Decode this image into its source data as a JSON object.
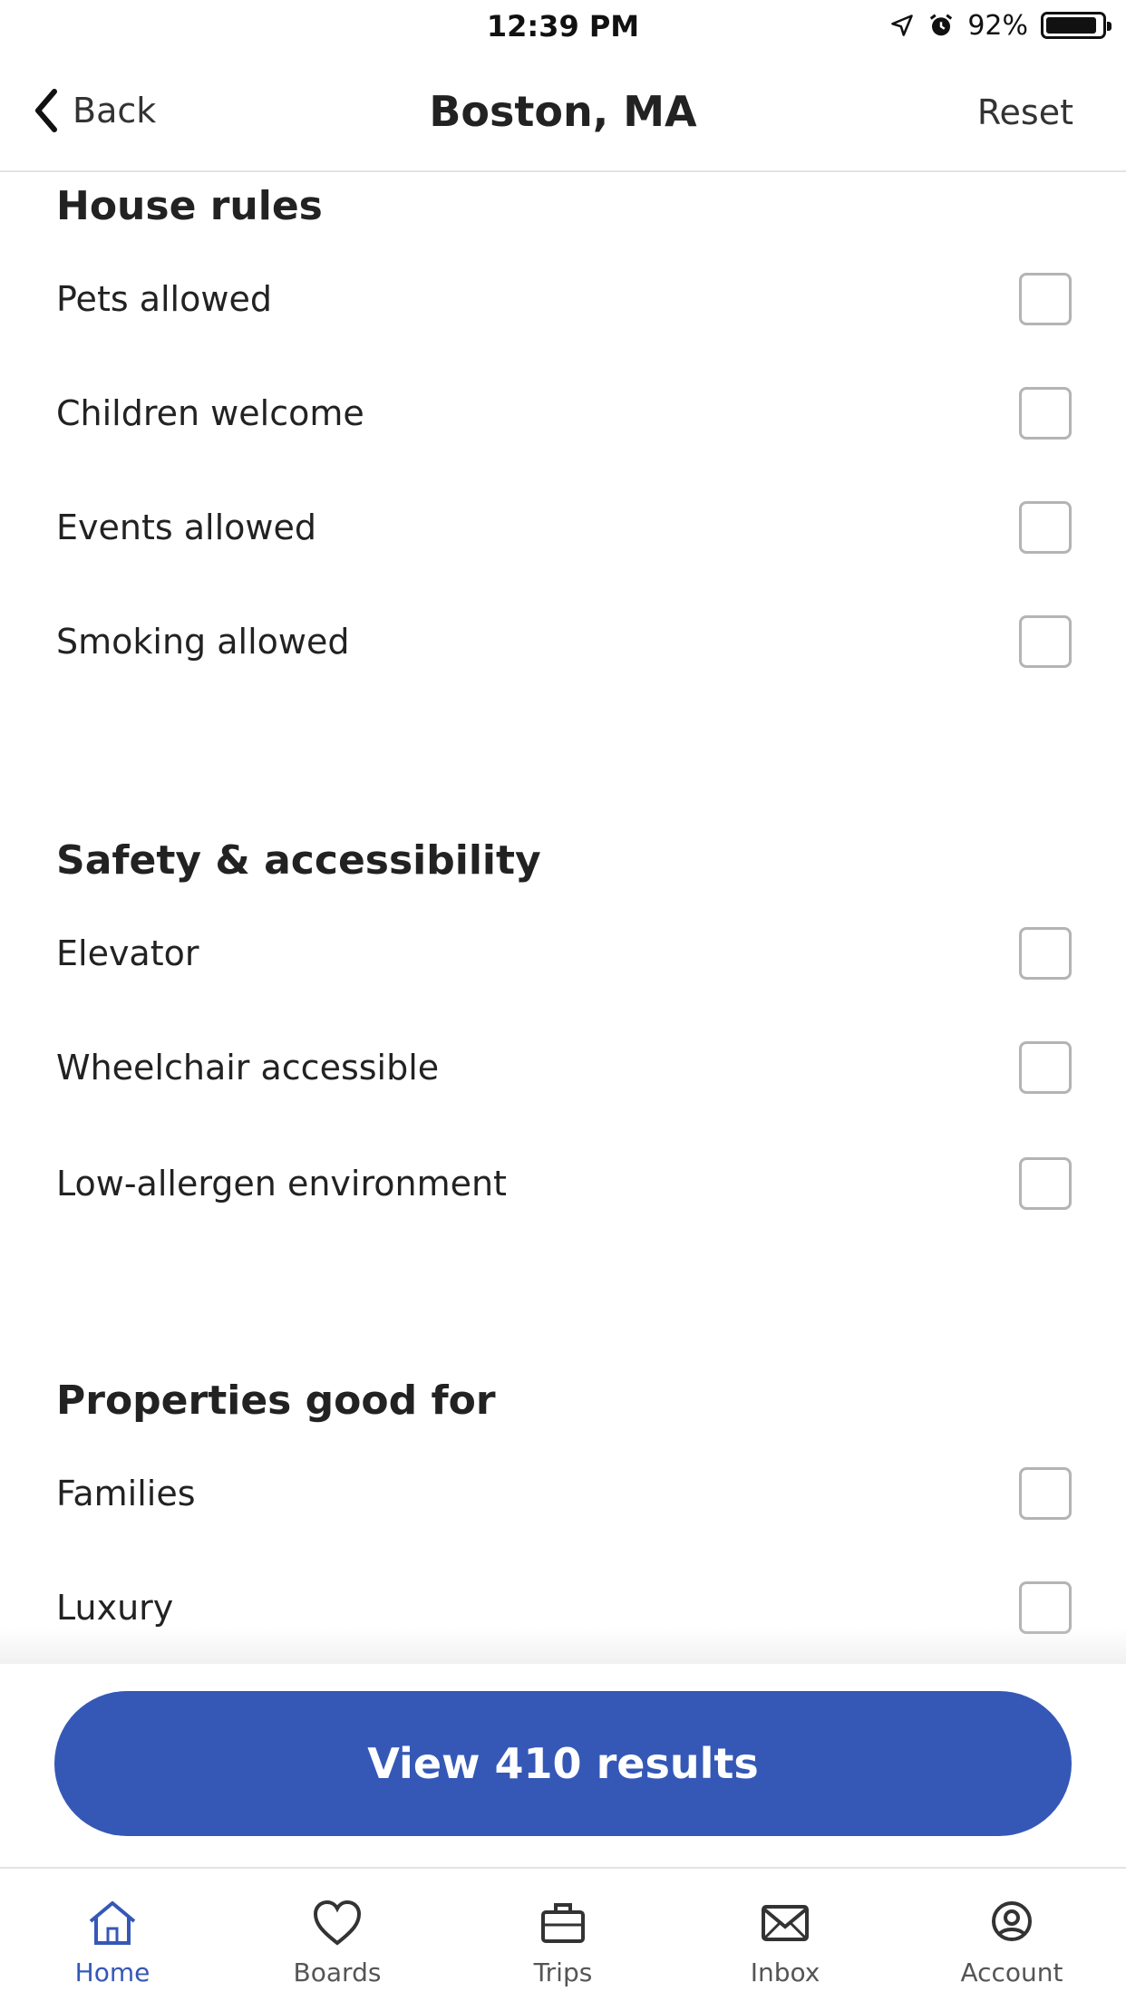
{
  "status": {
    "time": "12:39 PM",
    "battery": "92%",
    "battery_level": 0.92
  },
  "nav": {
    "back_label": "Back",
    "title": "Boston,  MA",
    "reset_label": "Reset"
  },
  "sections": [
    {
      "title": "House rules",
      "items": [
        "Pets allowed",
        "Children welcome",
        "Events allowed",
        "Smoking allowed"
      ]
    },
    {
      "title": "Safety & accessibility",
      "items": [
        "Elevator",
        "Wheelchair accessible",
        "Low-allergen environment"
      ]
    },
    {
      "title": "Properties good for",
      "items": [
        "Families",
        "Luxury"
      ]
    }
  ],
  "cta": {
    "label": "View 410 results"
  },
  "tabs": [
    {
      "label": "Home",
      "icon": "home-icon",
      "active": true
    },
    {
      "label": "Boards",
      "icon": "heart-icon",
      "active": false
    },
    {
      "label": "Trips",
      "icon": "suitcase-icon",
      "active": false
    },
    {
      "label": "Inbox",
      "icon": "mail-icon",
      "active": false
    },
    {
      "label": "Account",
      "icon": "account-icon",
      "active": false
    }
  ],
  "colors": {
    "accent": "#3558b7",
    "checkbox_border": "#b4b4b4"
  }
}
